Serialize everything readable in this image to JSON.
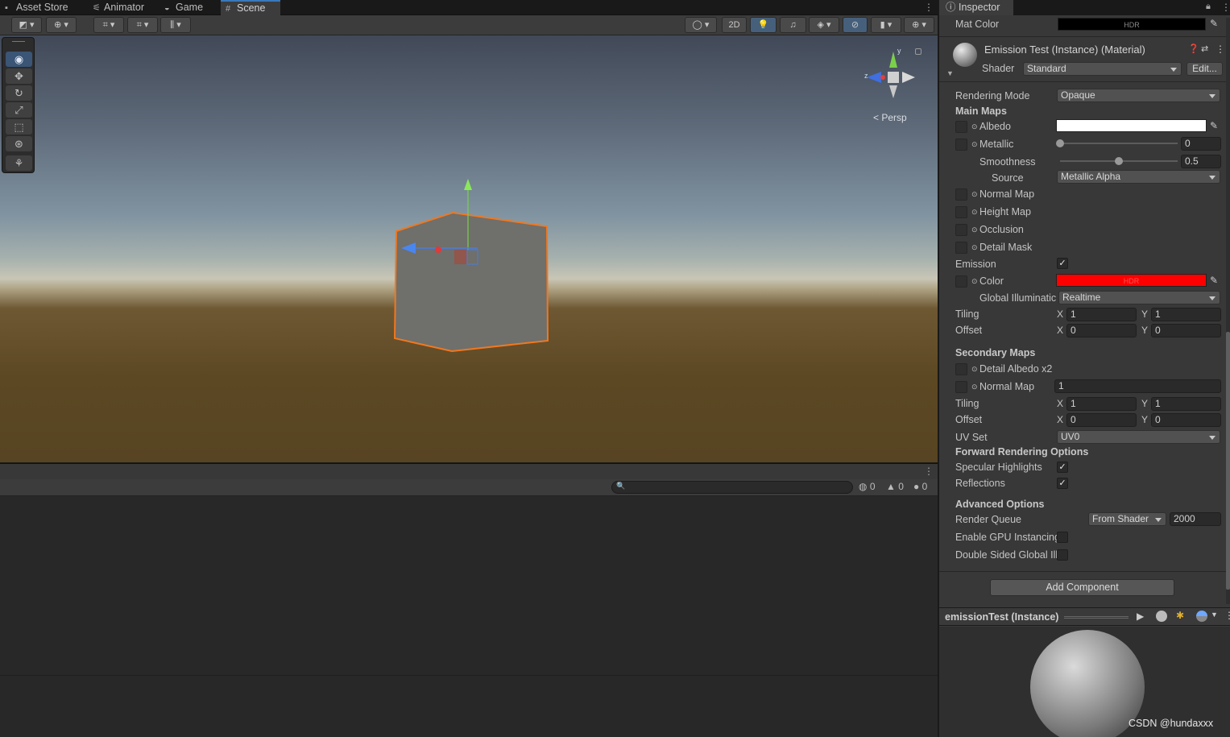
{
  "tabs": [
    {
      "label": "Asset Store"
    },
    {
      "label": "Animator"
    },
    {
      "label": "Game"
    },
    {
      "label": "Scene"
    }
  ],
  "scene_toolbar": {
    "twod_label": "2D"
  },
  "gizmo": {
    "y": "y",
    "z": "z",
    "persp": "Persp"
  },
  "console": {
    "error_count": "0",
    "warning_count": "0",
    "info_count": "0"
  },
  "inspector": {
    "tab_label": "Inspector",
    "mat_color_label": "Mat Color",
    "hdr": "HDR",
    "material_title": "Emission Test (Instance) (Material)",
    "shader_label": "Shader",
    "shader_value": "Standard",
    "edit_label": "Edit...",
    "rendering_mode_label": "Rendering Mode",
    "rendering_mode_value": "Opaque",
    "main_maps": "Main Maps",
    "albedo": "Albedo",
    "metallic": "Metallic",
    "metallic_value": "0",
    "metallic_fraction": 0,
    "smoothness": "Smoothness",
    "smoothness_value": "0.5",
    "smoothness_fraction": 0.5,
    "source": "Source",
    "source_value": "Metallic Alpha",
    "normal_map": "Normal Map",
    "height_map": "Height Map",
    "occlusion": "Occlusion",
    "detail_mask": "Detail Mask",
    "emission": "Emission",
    "color": "Color",
    "emission_color": "#ff0000",
    "albedo_color": "#ffffff",
    "gi_label": "Global Illuminatic",
    "gi_value": "Realtime",
    "tiling": "Tiling",
    "offset": "Offset",
    "x": "X",
    "y": "Y",
    "tiling_x": "1",
    "tiling_y": "1",
    "offset_x": "0",
    "offset_y": "0",
    "secondary_maps": "Secondary Maps",
    "detail_albedo": "Detail Albedo x2",
    "normal_map2": "Normal Map",
    "normal_map2_value": "1",
    "tiling2_x": "1",
    "tiling2_y": "1",
    "offset2_x": "0",
    "offset2_y": "0",
    "uv_set": "UV Set",
    "uv_set_value": "UV0",
    "forward_options": "Forward Rendering Options",
    "specular": "Specular Highlights",
    "reflections": "Reflections",
    "advanced": "Advanced Options",
    "render_queue": "Render Queue",
    "render_queue_mode": "From Shader",
    "render_queue_value": "2000",
    "gpu_instancing": "Enable GPU Instancing",
    "double_sided": "Double Sided Global Ill",
    "add_component": "Add Component",
    "preview_title": "emissionTest (Instance)"
  },
  "watermark": "CSDN @hundaxxx"
}
